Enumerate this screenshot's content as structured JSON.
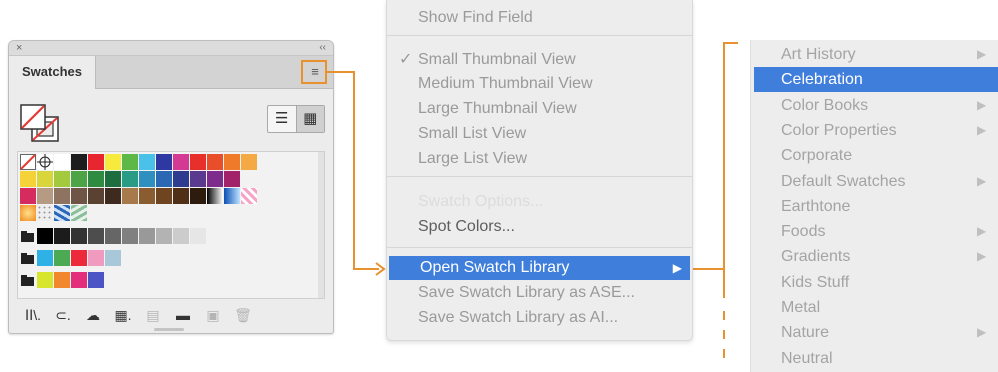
{
  "panel": {
    "close_glyph": "×",
    "collapse_glyph": "‹‹",
    "tab_label": "Swatches",
    "menu_glyph": "≡",
    "view_list_glyph": "☰",
    "view_grid_glyph": "▦",
    "footer_icons": [
      {
        "name": "swatch-libraries-icon",
        "glyph": "ⅠⅠ\\."
      },
      {
        "name": "show-kinds-icon",
        "glyph": "⊂."
      },
      {
        "name": "color-group-edit-icon",
        "glyph": "☁"
      },
      {
        "name": "swatch-options-icon",
        "glyph": "▦."
      },
      {
        "name": "new-color-group-icon",
        "glyph": "▤"
      },
      {
        "name": "new-folder-icon",
        "glyph": "▬"
      },
      {
        "name": "new-swatch-icon",
        "glyph": "▣"
      },
      {
        "name": "delete-swatch-icon",
        "glyph": "🗑"
      }
    ],
    "swatch_rows": [
      [
        "none",
        "register",
        "#ffffff",
        "#1d1d1d",
        "#e8262f",
        "#f6ea3c",
        "#5db848",
        "#4ac1e8",
        "#2d39a0",
        "#d43a93",
        "#e7302a",
        "#e84e2a",
        "#ef7a2a",
        "#f4a945"
      ],
      [
        "#f4d238",
        "#d9d63b",
        "#a3c93f",
        "#4ca446",
        "#2e8b3f",
        "#1e6d3f",
        "#2a9c86",
        "#2f8fbf",
        "#2a68b3",
        "#2e3b8f",
        "#5a3a8f",
        "#7d2c8b",
        "#a3236b"
      ],
      [
        "#d52b5f",
        "#b69b84",
        "#8f7361",
        "#6e5546",
        "#5a4233",
        "#3f2a1f",
        "#a77a4c",
        "#8a5d30",
        "#6e4421",
        "#4f2f15",
        "#2d1b0d",
        "grad-bw",
        "grad-blue",
        "pattern-pink"
      ],
      [
        "grad-orange",
        "pattern-dots",
        "pattern-blue",
        "pattern-green"
      ],
      [
        "folder",
        "#000000",
        "#1c1c1c",
        "#333333",
        "#4d4d4d",
        "#666666",
        "#808080",
        "#999999",
        "#b3b3b3",
        "#cccccc",
        "#e6e6e6"
      ],
      [
        "folder",
        "#2eb2e6",
        "#4caa55",
        "#ec2a3b",
        "#f09ac0",
        "#a8c8d9"
      ],
      [
        "folder",
        "#d7e52e",
        "#f2882e",
        "#e32e7c",
        "#4a54c4"
      ]
    ]
  },
  "menu": {
    "items": [
      {
        "label": "Show Find Field",
        "state": "normal"
      },
      {
        "sep": true
      },
      {
        "label": "Small Thumbnail View",
        "state": "normal",
        "checked": true
      },
      {
        "label": "Medium Thumbnail View",
        "state": "normal"
      },
      {
        "label": "Large Thumbnail View",
        "state": "normal"
      },
      {
        "label": "Small List View",
        "state": "normal"
      },
      {
        "label": "Large List View",
        "state": "normal"
      },
      {
        "sep": true
      },
      {
        "label": "Swatch Options...",
        "state": "disabled"
      },
      {
        "label": "Spot Colors...",
        "state": "dark"
      },
      {
        "sep": true
      },
      {
        "label": "Open Swatch Library",
        "state": "selected",
        "submenu": true
      },
      {
        "label": "Save Swatch Library as ASE...",
        "state": "normal"
      },
      {
        "label": "Save Swatch Library as AI...",
        "state": "normal"
      }
    ],
    "check_glyph": "✓",
    "arrow_glyph": "▶"
  },
  "library_menu": {
    "items": [
      {
        "label": "Art History",
        "submenu": true
      },
      {
        "label": "Celebration",
        "selected": true
      },
      {
        "label": "Color Books",
        "submenu": true
      },
      {
        "label": "Color Properties",
        "submenu": true
      },
      {
        "label": "Corporate"
      },
      {
        "label": "Default Swatches",
        "submenu": true
      },
      {
        "label": "Earthtone"
      },
      {
        "label": "Foods",
        "submenu": true
      },
      {
        "label": "Gradients",
        "submenu": true
      },
      {
        "label": "Kids Stuff"
      },
      {
        "label": "Metal"
      },
      {
        "label": "Nature",
        "submenu": true
      },
      {
        "label": "Neutral"
      }
    ],
    "arrow_glyph": "▶"
  },
  "colors": {
    "callout": "#e8912f",
    "selection": "#3f7edb"
  }
}
